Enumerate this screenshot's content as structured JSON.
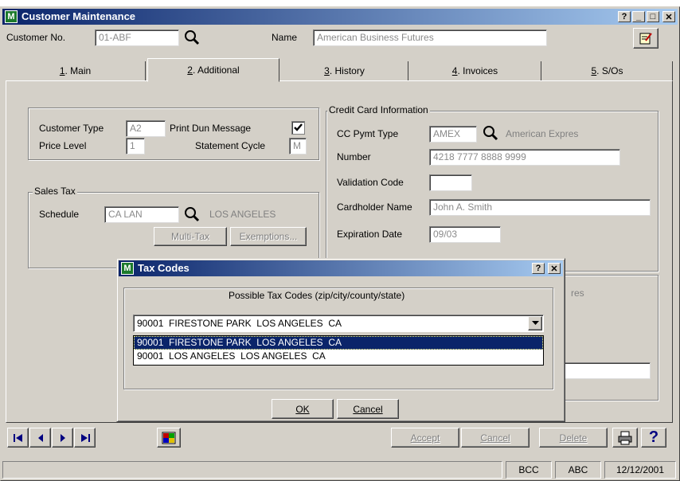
{
  "window": {
    "title": "Customer Maintenance"
  },
  "header": {
    "customer_no_label": "Customer No.",
    "customer_no_value": "01-ABF",
    "name_label": "Name",
    "name_value": "American Business Futures"
  },
  "tabs": [
    {
      "num": "1",
      "label": ". Main"
    },
    {
      "num": "2",
      "label": ". Additional"
    },
    {
      "num": "3",
      "label": ". History"
    },
    {
      "num": "4",
      "label": ". Invoices"
    },
    {
      "num": "5",
      "label": ". S/Os"
    }
  ],
  "left": {
    "customer_type_label": "Customer Type",
    "customer_type_value": "A2",
    "print_dun_label": "Print Dun Message",
    "print_dun_checked": true,
    "price_level_label": "Price Level",
    "price_level_value": "1",
    "statement_cycle_label": "Statement Cycle",
    "statement_cycle_value": "M",
    "sales_tax_title": "Sales Tax",
    "schedule_label": "Schedule",
    "schedule_value": "CA LAN",
    "schedule_desc": "LOS ANGELES",
    "multitax_label": "Multi-Tax",
    "exemptions_label": "Exemptions..."
  },
  "credit": {
    "title": "Credit Card Information",
    "cc_type_label": "CC Pymt Type",
    "cc_type_value": "AMEX",
    "cc_type_desc": "American Expres",
    "number_label": "Number",
    "number_value": "4218 7777 8888 9999",
    "validation_label": "Validation Code",
    "validation_value": "",
    "cardholder_label": "Cardholder Name",
    "cardholder_value": "John A. Smith",
    "expiration_label": "Expiration Date",
    "expiration_value": "09/03",
    "hidden_text": "res"
  },
  "toolbar": {
    "accept": "Accept",
    "cancel": "Cancel",
    "delete": "Delete"
  },
  "status": {
    "s1": "BCC",
    "s2": "ABC",
    "date": "12/12/2001"
  },
  "dialog": {
    "title": "Tax Codes",
    "group_title": "Possible Tax Codes (zip/city/county/state)",
    "selected": "90001  FIRESTONE PARK  LOS ANGELES  CA",
    "options": [
      "90001  FIRESTONE PARK  LOS ANGELES  CA",
      "90001  LOS ANGELES  LOS ANGELES  CA"
    ],
    "ok": "OK",
    "cancel": "Cancel"
  },
  "colors": {
    "titlebar_start": "#0a246a",
    "titlebar_end": "#a6caf0",
    "selection": "#0a246a",
    "face": "#d4d0c8"
  }
}
